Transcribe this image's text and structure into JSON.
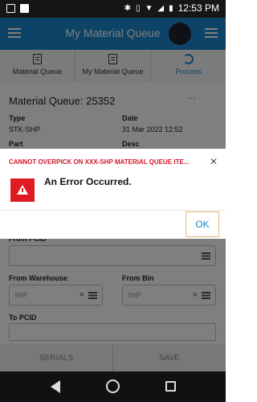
{
  "status_bar": {
    "time": "12:53 PM"
  },
  "header": {
    "title": "My Material Queue"
  },
  "tabs": [
    {
      "label": "Material Queue"
    },
    {
      "label": "My Material Queue"
    },
    {
      "label": "Process"
    }
  ],
  "content": {
    "queue_title": "Material Queue: 25352",
    "more": "...",
    "type_label": "Type",
    "type_value": "STK-SHP",
    "date_label": "Date",
    "date_value": "31 Mar 2022 12:52",
    "part_label": "Part",
    "desc_label": "Desc",
    "from_pcid_label": "From PCID",
    "from_warehouse_label": "From Warehouse",
    "from_warehouse_value": "SHP",
    "from_bin_label": "From Bin",
    "from_bin_value": "SHP",
    "to_pcid_label": "To PCID",
    "serials_button": "SERIALS",
    "save_button": "SAVE"
  },
  "dialog": {
    "title": "CANNOT OVERPICK ON XXX-SHP MATERIAL QUEUE ITE...",
    "message": "An Error Occurred.",
    "ok_label": "OK"
  },
  "colors": {
    "accent": "#1b86cc",
    "error": "#d3182b"
  }
}
